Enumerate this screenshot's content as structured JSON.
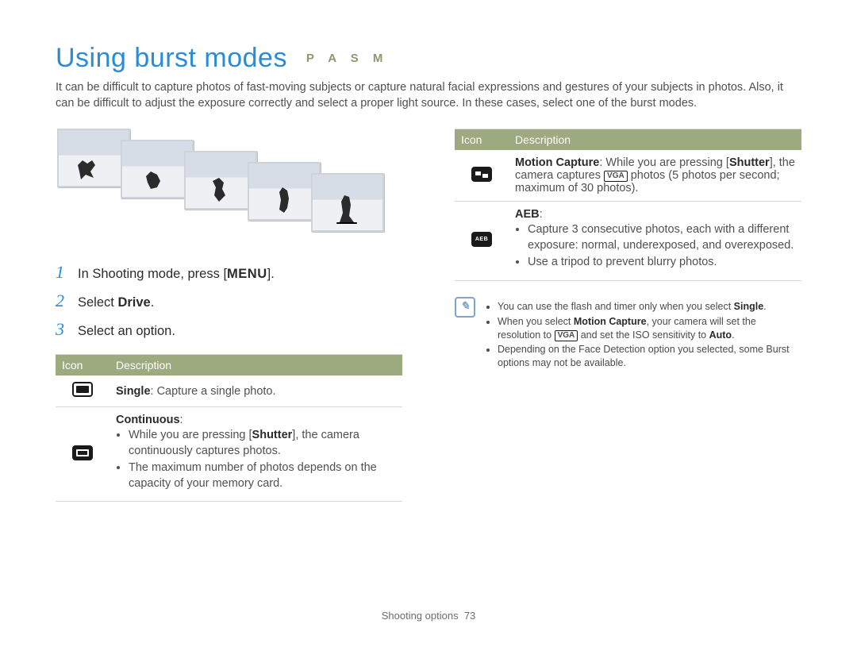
{
  "title": {
    "main": "Using burst modes",
    "modes": "P A S M"
  },
  "intro": "It can be difficult to capture photos of fast-moving subjects or capture natural facial expressions and gestures of your subjects in photos. Also, it can be difficult to adjust the exposure correctly and select a proper light source. In these cases, select one of the burst modes.",
  "steps": {
    "s1_pre": "In Shooting mode, press [",
    "s1_chip": "MENU",
    "s1_post": "].",
    "s2_pre": "Select ",
    "s2_strong": "Drive",
    "s2_post": ".",
    "s3": "Select an option."
  },
  "table_headers": {
    "icon": "Icon",
    "desc": "Description"
  },
  "left_rows": {
    "single": {
      "strong": "Single",
      "text": ": Capture a single photo."
    },
    "cont": {
      "strong": "Continuous",
      "colon": ":",
      "b1_pre": "While you are pressing [",
      "b1_strong": "Shutter",
      "b1_post": "], the camera continuously captures photos.",
      "b2": "The maximum number of photos depends on the capacity of your memory card."
    }
  },
  "right_rows": {
    "motion": {
      "strong": "Motion Capture",
      "pre": ": While you are pressing [",
      "shutter": "Shutter",
      "mid": "], the camera captures ",
      "vga": "VGA",
      "post": " photos (5 photos per second; maximum of 30 photos)."
    },
    "aeb": {
      "strong": "AEB",
      "colon": ":",
      "b1": "Capture 3 consecutive photos, each with a different exposure: normal, underexposed, and overexposed.",
      "b2": "Use a tripod to prevent blurry photos."
    }
  },
  "note": {
    "n1_pre": "You can use the flash and timer only when you select ",
    "n1_strong": "Single",
    "n1_post": ".",
    "n2_pre": "When you select ",
    "n2_strong": "Motion Capture",
    "n2_mid": ", your camera will set the resolution to ",
    "n2_vga": "VGA",
    "n2_mid2": " and set the ISO sensitivity to ",
    "n2_strong2": "Auto",
    "n2_post": ".",
    "n3": "Depending on the Face Detection option you selected, some Burst options may not be available."
  },
  "footer": {
    "section": "Shooting options",
    "page": "73"
  }
}
